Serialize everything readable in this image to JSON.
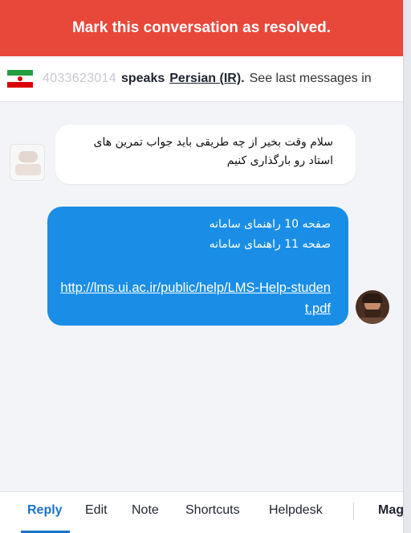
{
  "banner": {
    "text": "Mark this conversation as resolved."
  },
  "language_bar": {
    "flag": "iran-flag-icon",
    "phone": "4033623014",
    "speaks": "speaks",
    "language": "Persian (IR)",
    "period": ".",
    "see_more": "See last messages in"
  },
  "messages": [
    {
      "direction": "incoming",
      "lines": [
        "سلام وقت بخیر از چه طریقی باید جواب تمرین های",
        "استاد رو بارگذاری کنیم"
      ]
    },
    {
      "direction": "outgoing",
      "lines": [
        "صفحه 10 راهنمای سامانه",
        "صفحه 11 راهنمای سامانه"
      ],
      "link": "http://lms.ui.ac.ir/public/help/LMS-Help-student.pdf"
    }
  ],
  "tabs": {
    "reply": "Reply",
    "edit": "Edit",
    "note": "Note",
    "shortcuts": "Shortcuts",
    "helpdesk": "Helpdesk",
    "more": "Mag"
  },
  "colors": {
    "banner": "#e8483a",
    "outgoing_bubble": "#1a8ee6",
    "active_tab": "#1a73c8"
  }
}
